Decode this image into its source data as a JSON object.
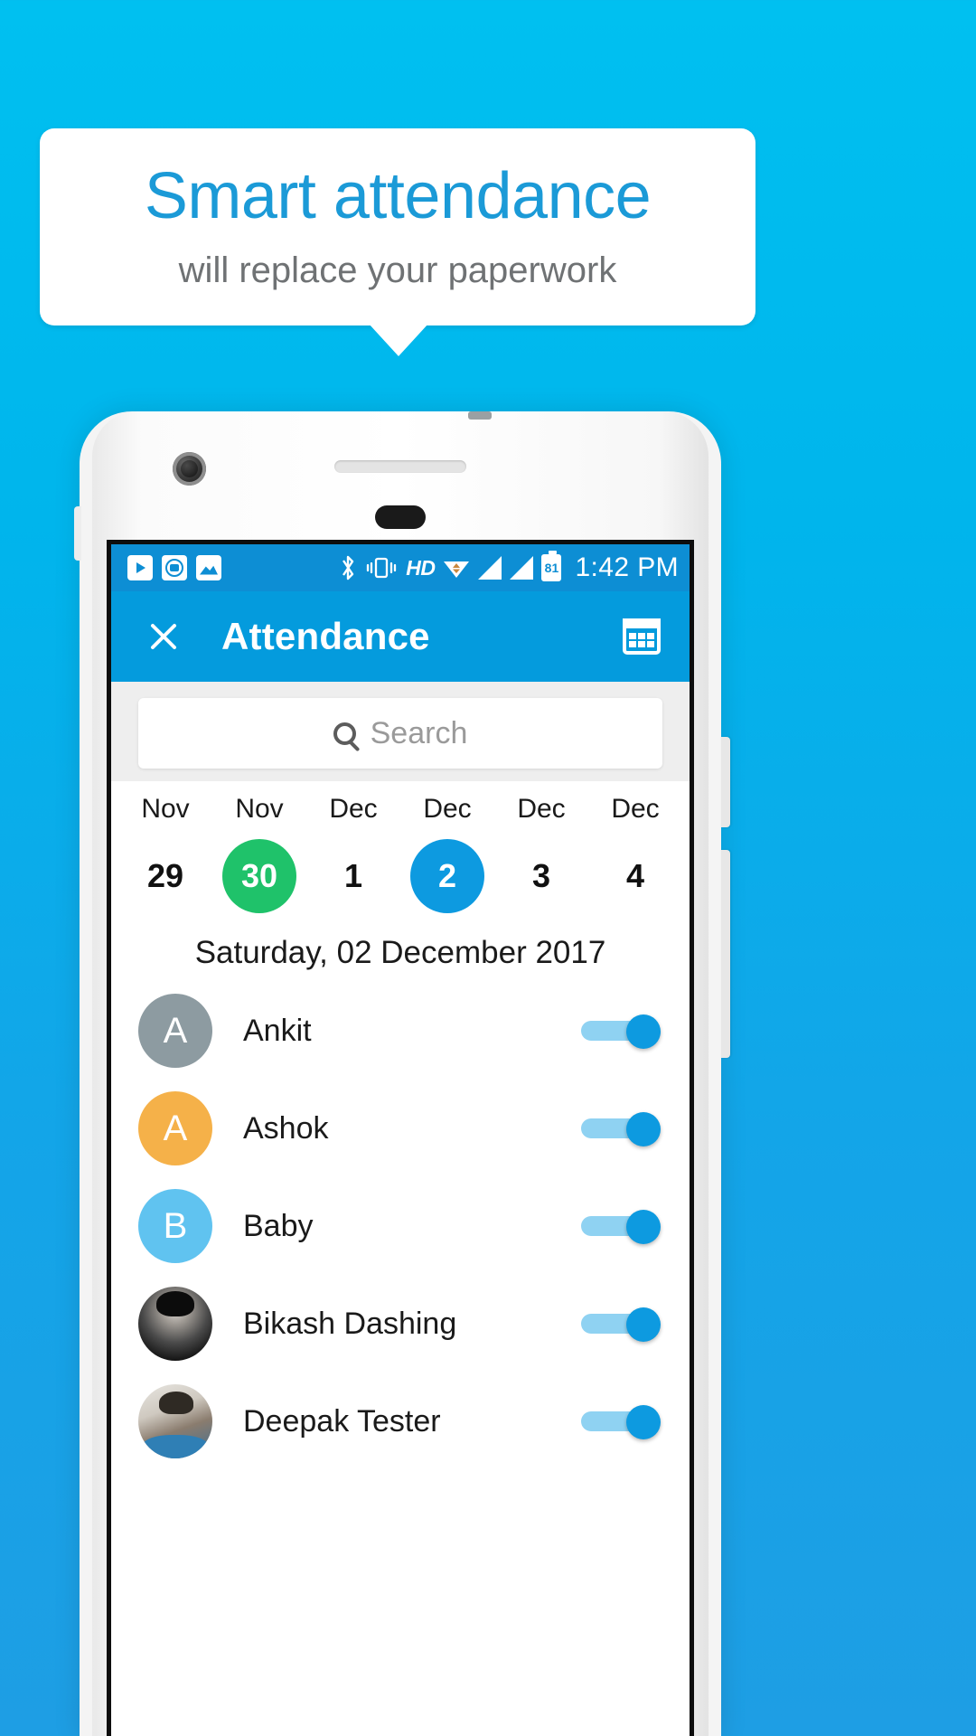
{
  "banner": {
    "title": "Smart attendance",
    "subtitle": "will replace your paperwork",
    "title_color": "#1b9ad7",
    "subtitle_color": "#6f7274"
  },
  "background_color": "#00b5ec",
  "phone": {
    "status_bar": {
      "left_icons": [
        "youtube-play-icon",
        "mi-camera-icon",
        "gallery-picture-icon"
      ],
      "right_icons": [
        "bluetooth-icon",
        "vibrate-icon",
        "hd-icon",
        "wifi-icon",
        "signal-sim1-icon",
        "signal-sim2-icon",
        "battery-icon"
      ],
      "hd_label": "HD",
      "battery_level": "81",
      "time": "1:42 PM",
      "background_color": "#0d8ed4"
    },
    "app_bar": {
      "close_label": "close-icon",
      "title": "Attendance",
      "calendar_label": "calendar-icon",
      "background_color": "#049bdd"
    },
    "search": {
      "placeholder": "Search",
      "value": "",
      "icon": "search-icon"
    },
    "date_strip": [
      {
        "month": "Nov",
        "day": "29",
        "state": "normal"
      },
      {
        "month": "Nov",
        "day": "30",
        "state": "today"
      },
      {
        "month": "Dec",
        "day": "1",
        "state": "normal"
      },
      {
        "month": "Dec",
        "day": "2",
        "state": "selected"
      },
      {
        "month": "Dec",
        "day": "3",
        "state": "normal"
      },
      {
        "month": "Dec",
        "day": "4",
        "state": "normal"
      }
    ],
    "selected_date_heading": "Saturday, 02 December 2017",
    "colors": {
      "today_chip": "#1fc26a",
      "selected_chip": "#0d9ae0",
      "toggle_on": "#0d9ae0",
      "toggle_track": "#8fd2f2"
    },
    "attendance_list": [
      {
        "name": "Ankit",
        "initial": "A",
        "avatar_type": "initial",
        "avatar_color": "#8d9ba1",
        "toggle": "on"
      },
      {
        "name": "Ashok",
        "initial": "A",
        "avatar_type": "initial",
        "avatar_color": "#f5b149",
        "toggle": "on"
      },
      {
        "name": "Baby",
        "initial": "B",
        "avatar_type": "initial",
        "avatar_color": "#60c3f0",
        "toggle": "on"
      },
      {
        "name": "Bikash Dashing",
        "initial": "",
        "avatar_type": "photo",
        "avatar_color": "#2b2b2b",
        "toggle": "on"
      },
      {
        "name": "Deepak Tester",
        "initial": "",
        "avatar_type": "photo",
        "avatar_color": "#7d8b94",
        "toggle": "on"
      }
    ]
  }
}
